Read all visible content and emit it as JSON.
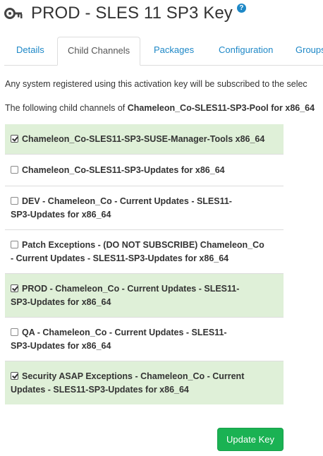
{
  "header": {
    "title": "PROD - SLES 11 SP3 Key",
    "help_glyph": "?",
    "key_icon": "key-icon",
    "help_icon": "help-icon"
  },
  "tabs": [
    {
      "label": "Details",
      "active": false
    },
    {
      "label": "Child Channels",
      "active": true
    },
    {
      "label": "Packages",
      "active": false
    },
    {
      "label": "Configuration",
      "active": false
    },
    {
      "label": "Groups",
      "active": false
    }
  ],
  "intro": {
    "line1": "Any system registered using this activation key will be subscribed to the selec",
    "line2_prefix": "The following child channels of ",
    "line2_channel": "Chameleon_Co-SLES11-SP3-Pool for x86_64"
  },
  "channels": [
    {
      "line1": "Chameleon_Co-SLES11-SP3-SUSE-Manager-Tools x86_64",
      "line2": "",
      "checked": true
    },
    {
      "line1": "Chameleon_Co-SLES11-SP3-Updates for x86_64",
      "line2": "",
      "checked": false
    },
    {
      "line1": "DEV - Chameleon_Co - Current Updates - SLES11-",
      "line2": "SP3-Updates for x86_64",
      "checked": false
    },
    {
      "line1": "Patch Exceptions - (DO NOT SUBSCRIBE) Chameleon_Co",
      "line2": "- Current Updates - SLES11-SP3-Updates for x86_64",
      "checked": false
    },
    {
      "line1": "PROD - Chameleon_Co - Current Updates - SLES11-",
      "line2": "SP3-Updates for x86_64",
      "checked": true
    },
    {
      "line1": "QA - Chameleon_Co - Current Updates - SLES11-",
      "line2": "SP3-Updates for x86_64",
      "checked": false
    },
    {
      "line1": "Security ASAP Exceptions - Chameleon_Co - Current",
      "line2": "Updates - SLES11-SP3-Updates for x86_64",
      "checked": true
    }
  ],
  "actions": {
    "update_label": "Update Key"
  },
  "colors": {
    "link": "#1e88c7",
    "checked_row_bg": "#dff0d8",
    "button_bg": "#1ab253"
  }
}
